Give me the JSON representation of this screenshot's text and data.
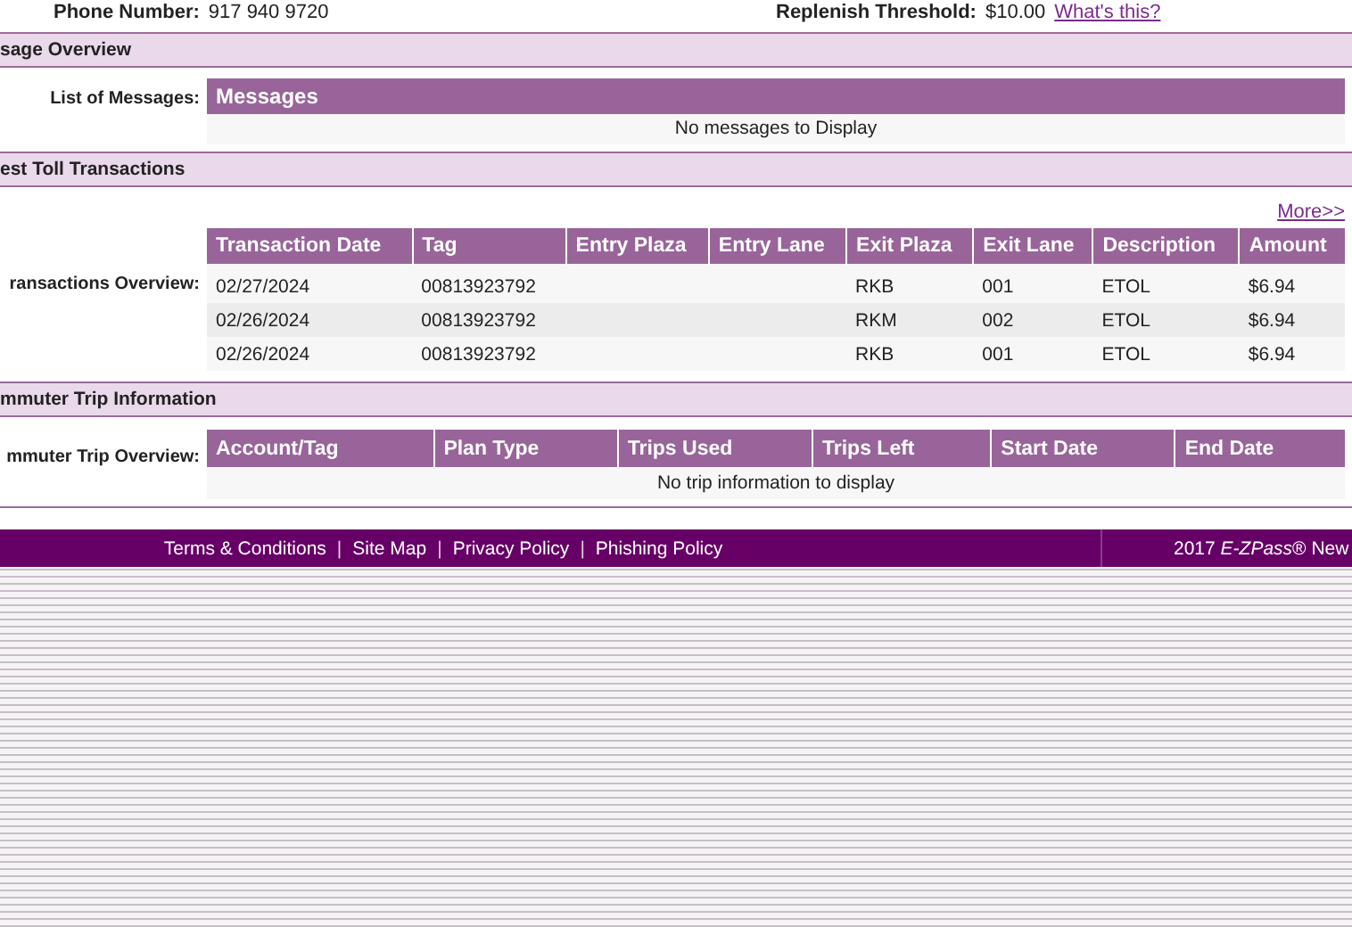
{
  "account_info": [
    {
      "label": "Phone Number:",
      "value": "917 940 9720"
    },
    {
      "label": "Replenish Threshold:",
      "value": "$10.00",
      "link": "What's this?"
    }
  ],
  "message_overview": {
    "heading": "sage Overview",
    "label": "List of Messages:",
    "table_title": "Messages",
    "empty_text": "No messages to Display"
  },
  "toll_transactions": {
    "heading": "est Toll Transactions",
    "more_link": "More>>",
    "label": "ransactions Overview:",
    "columns": [
      "Transaction Date",
      "Tag",
      "Entry Plaza",
      "Entry Lane",
      "Exit Plaza",
      "Exit Lane",
      "Description",
      "Amount"
    ],
    "rows": [
      [
        "02/27/2024",
        "00813923792",
        "",
        "",
        "RKB",
        "001",
        "ETOL",
        "$6.94"
      ],
      [
        "02/26/2024",
        "00813923792",
        "",
        "",
        "RKM",
        "002",
        "ETOL",
        "$6.94"
      ],
      [
        "02/26/2024",
        "00813923792",
        "",
        "",
        "RKB",
        "001",
        "ETOL",
        "$6.94"
      ]
    ]
  },
  "commuter_trips": {
    "heading": "mmuter Trip Information",
    "label": "mmuter Trip Overview:",
    "columns": [
      "Account/Tag",
      "Plan Type",
      "Trips Used",
      "Trips Left",
      "Start Date",
      "End Date"
    ],
    "empty_text": "No trip information to display"
  },
  "footer": {
    "items": [
      {
        "kind": "link",
        "text": "Terms & Conditions"
      },
      {
        "kind": "separator",
        "text": "|"
      },
      {
        "kind": "link",
        "text": "Site Map"
      },
      {
        "kind": "separator",
        "text": "|"
      },
      {
        "kind": "link",
        "text": "Privacy Policy"
      },
      {
        "kind": "separator",
        "text": "|"
      },
      {
        "kind": "link",
        "text": "Phishing Policy"
      }
    ],
    "copyright": "2017 *E-ZPass*® New"
  }
}
